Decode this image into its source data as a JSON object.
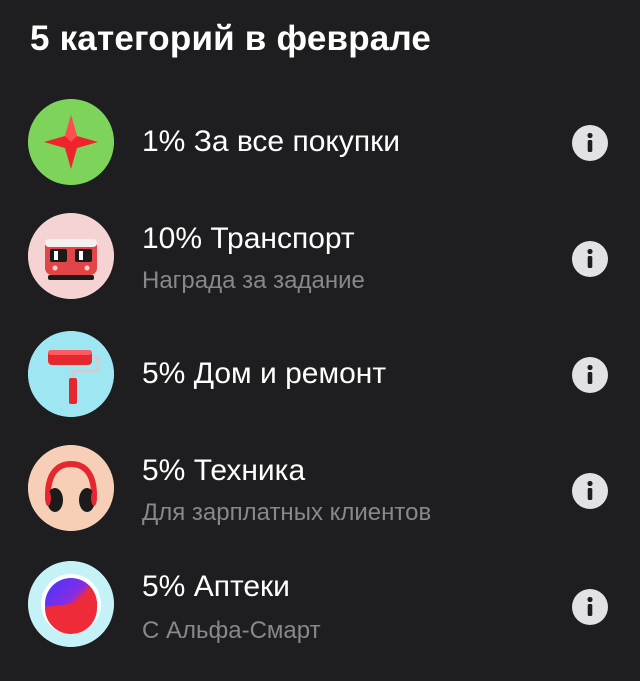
{
  "header": {
    "title": "5 категорий в феврале"
  },
  "categories": [
    {
      "label": "1% За все покупки",
      "sublabel": "",
      "icon": "red-star-icon",
      "icon_bg": "#7ed35a"
    },
    {
      "label": "10% Транспорт",
      "sublabel": "Награда за задание",
      "icon": "train-icon",
      "icon_bg": "#f5d3d3"
    },
    {
      "label": "5% Дом и ремонт",
      "sublabel": "",
      "icon": "paint-roller-icon",
      "icon_bg": "#9fe6f3"
    },
    {
      "label": "5% Техника",
      "sublabel": "Для зарплатных клиентов",
      "icon": "headphones-icon",
      "icon_bg": "#f7cfb7"
    },
    {
      "label": "5% Аптеки",
      "sublabel": "С Альфа-Смарт",
      "icon": "alfa-smart-icon",
      "icon_bg": "#c5f2f7"
    }
  ],
  "colors": {
    "background": "#1e1e20",
    "text_primary": "#ffffff",
    "text_secondary": "#87878c",
    "info_icon": "#e1e1e6"
  }
}
